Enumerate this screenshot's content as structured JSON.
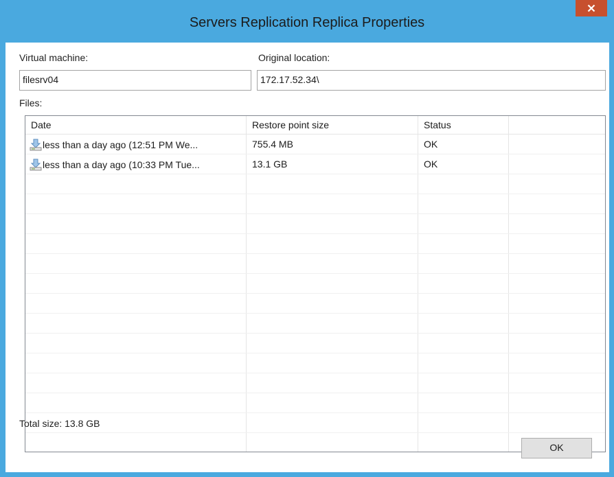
{
  "window": {
    "title": "Servers Replication Replica Properties",
    "accent_color": "#4aa9df",
    "close_color": "#c7502e",
    "close_icon": "close-icon"
  },
  "form": {
    "vm_label": "Virtual machine:",
    "vm_value": "filesrv04",
    "location_label": "Original location:",
    "location_value": "172.17.52.34\\",
    "files_label": "Files:"
  },
  "table": {
    "columns": [
      "Date",
      "Restore point size",
      "Status"
    ],
    "rows": [
      {
        "date": "less than a day ago (12:51 PM We...",
        "size": "755.4 MB",
        "status": "OK",
        "icon": "restore-point-icon"
      },
      {
        "date": "less than a day ago (10:33 PM Tue...",
        "size": "13.1 GB",
        "status": "OK",
        "icon": "restore-point-icon"
      }
    ]
  },
  "footer": {
    "total_size": "Total size: 13.8 GB",
    "ok_label": "OK"
  }
}
